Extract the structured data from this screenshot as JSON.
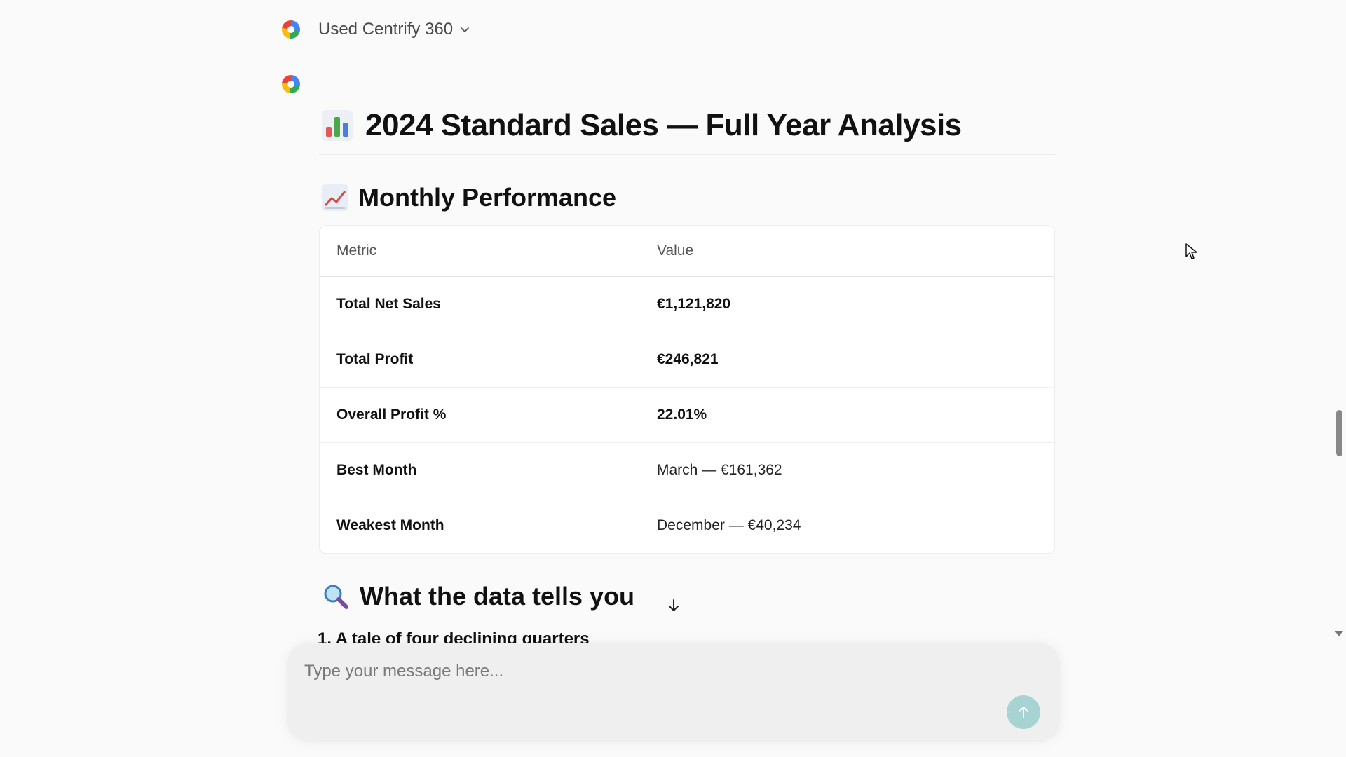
{
  "header": {
    "model_name": "Used Centrify 360",
    "logo_icon": "centrify-logo-icon"
  },
  "message": {
    "title": "2024 Standard Sales — Full Year Analysis",
    "title_emoji": "bar-chart-emoji",
    "section1_title": "Monthly Performance",
    "section1_emoji": "chart-increasing-emoji",
    "table": {
      "headers": [
        "Metric",
        "Value"
      ],
      "rows": [
        {
          "metric": "Total Net Sales",
          "value": "€1,121,820"
        },
        {
          "metric": "Total Profit",
          "value": "€246,821"
        },
        {
          "metric": "Overall Profit %",
          "value": "22.01%"
        },
        {
          "metric": "Best Month",
          "value": "March — €161,362"
        },
        {
          "metric": "Weakest Month",
          "value": "December — €40,234"
        }
      ]
    },
    "section2_title": "What the data tells you",
    "section2_emoji": "magnifying-glass-emoji",
    "subheading_partial": "1. A tale of four declining quarters"
  },
  "composer": {
    "placeholder": "Type your message here...",
    "send_icon": "arrow-up-icon"
  },
  "colors": {
    "background": "#fafafa",
    "send_button": "#a7d3d3",
    "composer_bg": "#efefef"
  }
}
